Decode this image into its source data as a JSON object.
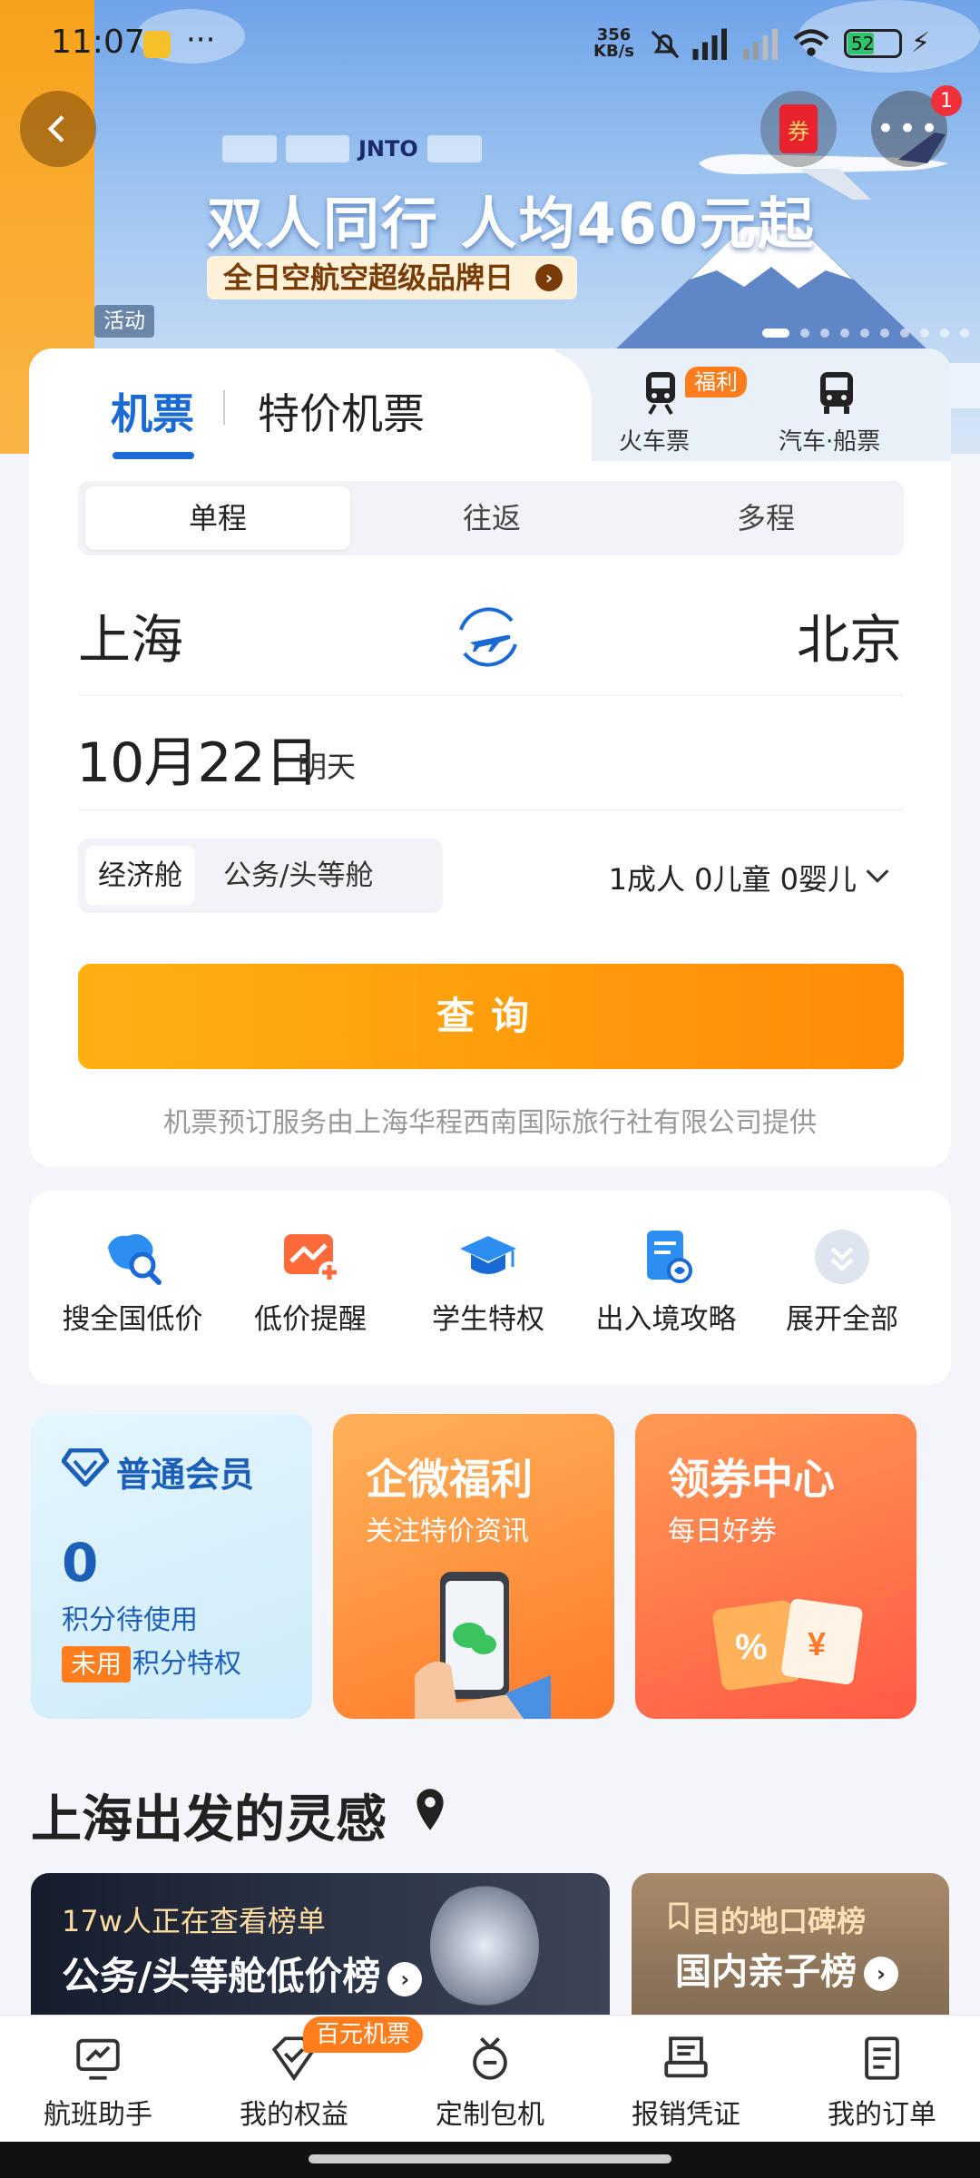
{
  "status": {
    "time": "11:07",
    "net_speed_top": "356",
    "net_speed_bottom": "KB/s",
    "battery": "52"
  },
  "banner": {
    "headline": "双人同行 人均460元起",
    "sub": "全日空航空超级品牌日",
    "tag": "活动",
    "logo_text": "JNTO"
  },
  "top_buttons": {
    "coupon_label": "券",
    "more_badge": "1"
  },
  "tabs": {
    "flight": "机票",
    "special": "特价机票",
    "train": "火车票",
    "train_badge": "福利",
    "bus": "汽车·船票"
  },
  "trip_type": {
    "one_way": "单程",
    "round_trip": "往返",
    "multi": "多程"
  },
  "route": {
    "from": "上海",
    "to": "北京"
  },
  "date": {
    "main": "10月22日",
    "sub": "明天"
  },
  "cabin": {
    "economy": "经济舱",
    "business": "公务/头等舱"
  },
  "passengers": "1成人 0儿童 0婴儿",
  "query_label": "查询",
  "provider": "机票预订服务由上海华程西南国际旅行社有限公司提供",
  "quick_links": [
    {
      "label": "搜全国低价",
      "icon": "map-search-icon"
    },
    {
      "label": "低价提醒",
      "icon": "price-alert-icon"
    },
    {
      "label": "学生特权",
      "icon": "graduation-cap-icon"
    },
    {
      "label": "出入境攻略",
      "icon": "document-guide-icon"
    },
    {
      "label": "展开全部",
      "icon": "expand-all-icon"
    }
  ],
  "member": {
    "title": "普通会员",
    "points": "0",
    "points_label": "积分待使用",
    "tag": "未用",
    "privilege": "积分特权"
  },
  "wecom": {
    "title": "企微福利",
    "sub": "关注特价资讯"
  },
  "coupon_center": {
    "title": "领券中心",
    "sub": "每日好券"
  },
  "inspiration": {
    "title": "上海出发的灵感",
    "card1_top": "17w人正在查看榜单",
    "card1_main": "公务/头等舱低价榜",
    "card2_top": "目的地口碑榜",
    "card2_main": "国内亲子榜"
  },
  "bottom_nav": [
    {
      "label": "航班助手",
      "icon": "flight-assistant-icon"
    },
    {
      "label": "我的权益",
      "icon": "benefits-icon"
    },
    {
      "label": "定制包机",
      "icon": "charter-icon"
    },
    {
      "label": "报销凭证",
      "icon": "receipt-icon"
    },
    {
      "label": "我的订单",
      "icon": "orders-icon"
    }
  ],
  "bottom_nav_badge": "百元机票",
  "colors": {
    "primary_blue": "#1a6ad6",
    "accent_orange": "#ff8b08",
    "badge_red": "#f0303a"
  }
}
